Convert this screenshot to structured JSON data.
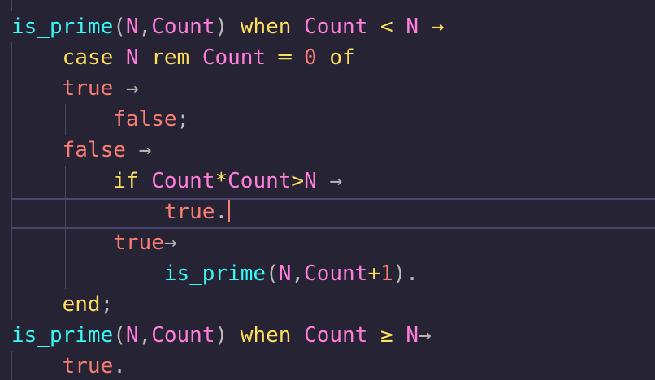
{
  "editor": {
    "theme_colors": {
      "background": "#262335",
      "function": "#36f9f6",
      "keyword": "#fede5d",
      "variable": "#ff7edb",
      "atom": "#fe4450",
      "number": "#f97e72",
      "operator": "#fede5d",
      "punctuation": "#bbbbbb",
      "arrow": "#b6b1b1",
      "cursor": "#f97e72"
    },
    "lines": [
      {
        "tokens": [
          {
            "t": "is_prime",
            "c": "#36f9f6"
          },
          {
            "t": "(",
            "c": "#bbbbbb"
          },
          {
            "t": "N",
            "c": "#ff7edb"
          },
          {
            "t": ",",
            "c": "#bbbbbb"
          },
          {
            "t": "Count",
            "c": "#ff7edb"
          },
          {
            "t": ") ",
            "c": "#bbbbbb"
          },
          {
            "t": "when",
            "c": "#fede5d"
          },
          {
            "t": " ",
            "c": "#bbbbbb"
          },
          {
            "t": "Count",
            "c": "#ff7edb"
          },
          {
            "t": " ",
            "c": "#bbbbbb"
          },
          {
            "t": "<",
            "c": "#fede5d"
          },
          {
            "t": " ",
            "c": "#bbbbbb"
          },
          {
            "t": "N",
            "c": "#ff7edb"
          },
          {
            "t": " ",
            "c": "#bbbbbb"
          },
          {
            "t": "→",
            "c": "#fede5d"
          }
        ]
      },
      {
        "tokens": [
          {
            "t": "    ",
            "c": "#bbbbbb"
          },
          {
            "t": "case",
            "c": "#fede5d"
          },
          {
            "t": " ",
            "c": "#bbbbbb"
          },
          {
            "t": "N",
            "c": "#ff7edb"
          },
          {
            "t": " ",
            "c": "#bbbbbb"
          },
          {
            "t": "rem",
            "c": "#fede5d"
          },
          {
            "t": " ",
            "c": "#bbbbbb"
          },
          {
            "t": "Count",
            "c": "#ff7edb"
          },
          {
            "t": " ",
            "c": "#bbbbbb"
          },
          {
            "t": "═",
            "c": "#fede5d"
          },
          {
            "t": " ",
            "c": "#bbbbbb"
          },
          {
            "t": "0",
            "c": "#f97e72"
          },
          {
            "t": " ",
            "c": "#bbbbbb"
          },
          {
            "t": "of",
            "c": "#fede5d"
          }
        ]
      },
      {
        "tokens": [
          {
            "t": "    ",
            "c": "#bbbbbb"
          },
          {
            "t": "true",
            "c": "#f97e72"
          },
          {
            "t": " ",
            "c": "#bbbbbb"
          },
          {
            "t": "→",
            "c": "#b6b1b1"
          }
        ]
      },
      {
        "tokens": [
          {
            "t": "        ",
            "c": "#bbbbbb"
          },
          {
            "t": "false",
            "c": "#f97e72"
          },
          {
            "t": ";",
            "c": "#bbbbbb"
          }
        ]
      },
      {
        "tokens": [
          {
            "t": "    ",
            "c": "#bbbbbb"
          },
          {
            "t": "false",
            "c": "#f97e72"
          },
          {
            "t": " ",
            "c": "#bbbbbb"
          },
          {
            "t": "→",
            "c": "#b6b1b1"
          }
        ]
      },
      {
        "tokens": [
          {
            "t": "        ",
            "c": "#bbbbbb"
          },
          {
            "t": "if",
            "c": "#fede5d"
          },
          {
            "t": " ",
            "c": "#bbbbbb"
          },
          {
            "t": "Count",
            "c": "#ff7edb"
          },
          {
            "t": "*",
            "c": "#fede5d"
          },
          {
            "t": "Count",
            "c": "#ff7edb"
          },
          {
            "t": ">",
            "c": "#fede5d"
          },
          {
            "t": "N",
            "c": "#ff7edb"
          },
          {
            "t": " ",
            "c": "#bbbbbb"
          },
          {
            "t": "→",
            "c": "#b6b1b1"
          }
        ]
      },
      {
        "tokens": [
          {
            "t": "            ",
            "c": "#bbbbbb"
          },
          {
            "t": "true",
            "c": "#f97e72"
          },
          {
            "t": ".",
            "c": "#bbbbbb"
          }
        ],
        "cursor": true
      },
      {
        "tokens": [
          {
            "t": "        ",
            "c": "#bbbbbb"
          },
          {
            "t": "true",
            "c": "#f97e72"
          },
          {
            "t": "→",
            "c": "#b6b1b1"
          }
        ]
      },
      {
        "tokens": [
          {
            "t": "            ",
            "c": "#bbbbbb"
          },
          {
            "t": "is_prime",
            "c": "#36f9f6"
          },
          {
            "t": "(",
            "c": "#bbbbbb"
          },
          {
            "t": "N",
            "c": "#ff7edb"
          },
          {
            "t": ",",
            "c": "#bbbbbb"
          },
          {
            "t": "Count",
            "c": "#ff7edb"
          },
          {
            "t": "+",
            "c": "#fede5d"
          },
          {
            "t": "1",
            "c": "#f97e72"
          },
          {
            "t": ").",
            "c": "#bbbbbb"
          }
        ]
      },
      {
        "tokens": [
          {
            "t": "    ",
            "c": "#bbbbbb"
          },
          {
            "t": "end",
            "c": "#fede5d"
          },
          {
            "t": ";",
            "c": "#bbbbbb"
          }
        ]
      },
      {
        "tokens": [
          {
            "t": "is_prime",
            "c": "#36f9f6"
          },
          {
            "t": "(",
            "c": "#bbbbbb"
          },
          {
            "t": "N",
            "c": "#ff7edb"
          },
          {
            "t": ",",
            "c": "#bbbbbb"
          },
          {
            "t": "Count",
            "c": "#ff7edb"
          },
          {
            "t": ") ",
            "c": "#bbbbbb"
          },
          {
            "t": "when",
            "c": "#fede5d"
          },
          {
            "t": " ",
            "c": "#bbbbbb"
          },
          {
            "t": "Count",
            "c": "#ff7edb"
          },
          {
            "t": " ",
            "c": "#bbbbbb"
          },
          {
            "t": "≥",
            "c": "#fede5d"
          },
          {
            "t": " ",
            "c": "#bbbbbb"
          },
          {
            "t": "N",
            "c": "#ff7edb"
          },
          {
            "t": "→",
            "c": "#b6b1b1"
          }
        ]
      },
      {
        "tokens": [
          {
            "t": "    ",
            "c": "#bbbbbb"
          },
          {
            "t": "true",
            "c": "#f97e72"
          },
          {
            "t": ".",
            "c": "#bbbbbb"
          }
        ]
      }
    ]
  }
}
